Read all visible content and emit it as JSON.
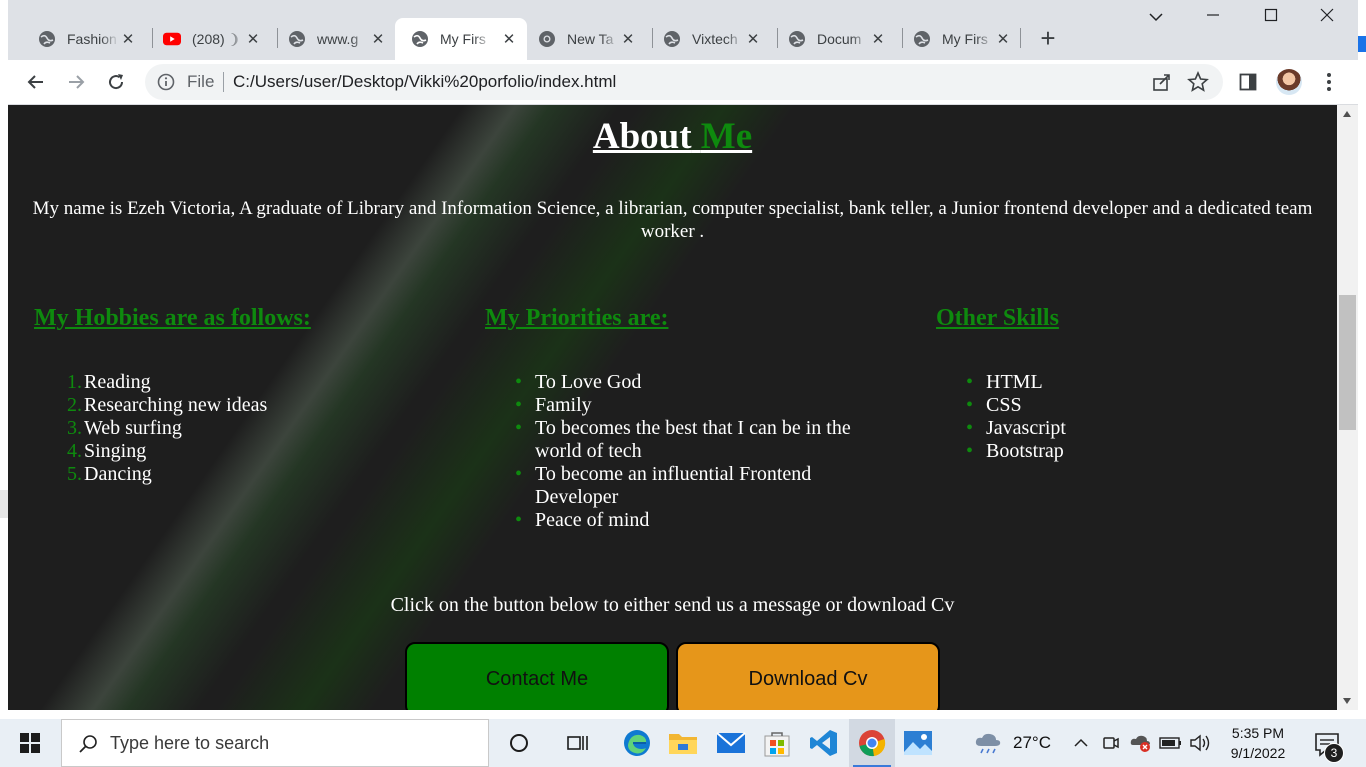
{
  "browser": {
    "tabs": [
      {
        "title": "Fashion",
        "icon": "globe-icon"
      },
      {
        "title": "(208) ❩",
        "icon": "youtube-icon"
      },
      {
        "title": "www.g",
        "icon": "globe-icon"
      },
      {
        "title": "My Firs",
        "icon": "globe-icon",
        "active": true
      },
      {
        "title": "New Ta",
        "icon": "chrome-icon"
      },
      {
        "title": "Vixtech",
        "icon": "globe-icon"
      },
      {
        "title": "Docum",
        "icon": "globe-icon"
      },
      {
        "title": "My Firs",
        "icon": "globe-icon"
      }
    ],
    "tab_close_glyph": "✕",
    "new_tab_glyph": "+",
    "window_controls": {
      "dropdown": "⌄",
      "minimize": "—",
      "maximize": "☐",
      "close": "✕"
    },
    "address": {
      "scheme_label": "File",
      "url": "C:/Users/user/Desktop/Vikki%20porfolio/index.html"
    }
  },
  "page": {
    "title_word1": "About",
    "title_word2": "Me",
    "intro": "My name is Ezeh Victoria, A graduate of Library and Information Science, a librarian, computer specialist, bank teller, a Junior frontend developer and a dedicated team worker .",
    "hobbies": {
      "heading": "My Hobbies are as follows:",
      "items": [
        "Reading",
        "Researching new ideas",
        "Web surfing",
        "Singing",
        "Dancing"
      ],
      "numbers": [
        "1.",
        "2.",
        "3.",
        "4.",
        "5."
      ]
    },
    "priorities": {
      "heading": "My Priorities are:",
      "items": [
        "To Love God",
        "Family",
        "To becomes the best that I can be in the world of tech",
        "To become an influential Frontend Developer",
        "Peace of mind"
      ]
    },
    "skills": {
      "heading": "Other Skills",
      "items": [
        "HTML",
        "CSS",
        "Javascript",
        "Bootstrap"
      ]
    },
    "cta": "Click on the button below to either send us a message or download Cv",
    "contact_button": "Contact Me",
    "download_button": "Download Cv",
    "colors": {
      "accent_green": "#0e8a0e",
      "contact_bg": "#008000",
      "download_bg": "#e6961a",
      "page_bg": "#1e1e1e"
    }
  },
  "taskbar": {
    "search_placeholder": "Type here to search",
    "apps": [
      "cortana-icon",
      "task-view-icon",
      "edge-icon",
      "file-explorer-icon",
      "mail-icon",
      "store-icon",
      "vscode-icon",
      "chrome-icon",
      "photos-icon"
    ],
    "weather": "27°C",
    "time": "5:35 PM",
    "date": "9/1/2022",
    "notifications": "3"
  }
}
